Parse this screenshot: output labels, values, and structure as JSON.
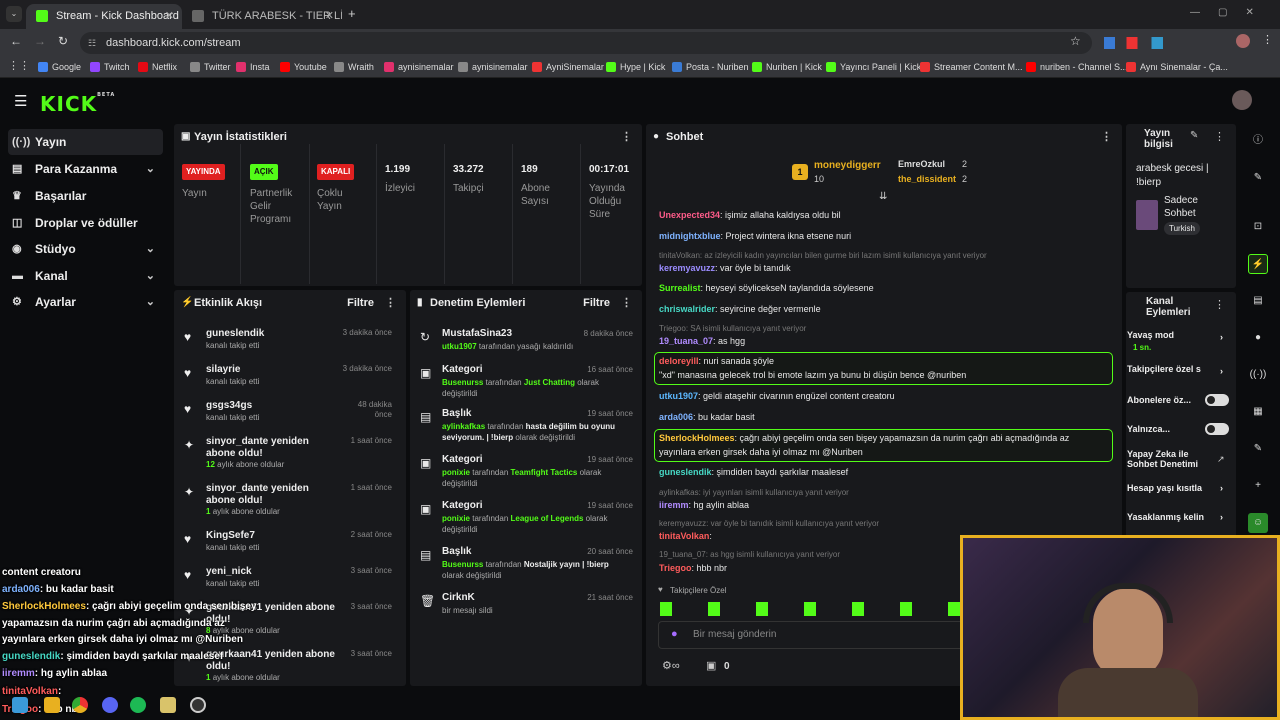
{
  "browser": {
    "tabs": [
      {
        "label": "Stream - Kick Dashboard"
      },
      {
        "label": "TÜRK ARABESK - TIER LİST - Tie"
      }
    ],
    "url": "dashboard.kick.com/stream",
    "bookmarks": [
      "Google",
      "Twitch",
      "Netflix",
      "Twitter",
      "Insta",
      "Youtube",
      "Wraith",
      "aynisinemalar",
      "aynisinemalar",
      "AyniSinemalar",
      "Hype | Kick",
      "Posta - Nuriben",
      "Nuriben | Kick",
      "Yayıncı Paneli | Kick",
      "Streamer Content M...",
      "nuriben - Channel S...",
      "Aynı Sinemalar - Ça..."
    ]
  },
  "sidebar": {
    "items": [
      "Yayın",
      "Para Kazanma",
      "Başarılar",
      "Droplar ve ödüller",
      "Stüdyo",
      "Kanal",
      "Ayarlar"
    ]
  },
  "stats": {
    "title": "Yayın İstatistikleri",
    "yayin_badge": "YAYINDA",
    "yayin_lbl": "Yayın",
    "partner_badge": "AÇIK",
    "partner_lbl": "Partnerlik Gelir Programı",
    "coklu_badge": "KAPALI",
    "coklu_lbl": "Çoklu Yayın",
    "izleyici_val": "1.199",
    "izleyici_lbl": "İzleyici",
    "takipci_val": "33.272",
    "takipci_lbl": "Takipçi",
    "abone_val": "189",
    "abone_lbl": "Abone Sayısı",
    "sure_val": "00:17:01",
    "sure_lbl": "Yayında Olduğu Süre"
  },
  "events": {
    "title": "Etkinlik Akışı",
    "filter": "Filtre",
    "items": [
      {
        "name": "guneslendik",
        "time": "3 dakika önce",
        "sub": "kanalı takip etti"
      },
      {
        "name": "silayrie",
        "time": "3 dakika önce",
        "sub": "kanalı takip etti"
      },
      {
        "name": "gsgs34gs",
        "time": "48 dakika önce",
        "sub": "kanalı takip etti"
      },
      {
        "name": "sinyor_dante yeniden abone oldu!",
        "time": "1 saat önce",
        "months": "12",
        "sub": "aylık abone oldular"
      },
      {
        "name": "sinyor_dante yeniden abone oldu!",
        "time": "1 saat önce",
        "months": "1",
        "sub": "aylık abone oldular"
      },
      {
        "name": "KingSefe7",
        "time": "2 saat önce",
        "sub": "kanalı takip etti"
      },
      {
        "name": "yeni_nick",
        "time": "3 saat önce",
        "sub": "kanalı takip etti"
      },
      {
        "name": "gourkaan41 yeniden abone oldu!",
        "time": "3 saat önce",
        "months": "8",
        "sub": "aylık abone oldular"
      },
      {
        "name": "gourkaan41 yeniden abone oldu!",
        "time": "3 saat önce",
        "months": "1",
        "sub": "aylık abone oldular"
      }
    ]
  },
  "moderation": {
    "title": "Denetim Eylemleri",
    "filter": "Filtre",
    "items": [
      {
        "name": "MustafaSina23",
        "time": "8 dakika önce",
        "user": "utku1907",
        "text": "tarafından yasağı kaldırıldı"
      },
      {
        "name": "Kategori",
        "time": "16 saat önce",
        "user": "Busenurss",
        "text": "tarafından",
        "value": "Just Chatting",
        "text2": "olarak değiştirildi"
      },
      {
        "name": "Başlık",
        "time": "19 saat önce",
        "user": "aylinkafkas",
        "text": "tarafından",
        "value": "hasta değilim bu oyunu seviyorum. | !bierp",
        "text2": "olarak değiştirildi"
      },
      {
        "name": "Kategori",
        "time": "19 saat önce",
        "user": "ponixie",
        "text": "tarafından",
        "value": "Teamfight Tactics",
        "text2": "olarak değiştirildi"
      },
      {
        "name": "Kategori",
        "time": "19 saat önce",
        "user": "ponixie",
        "text": "tarafından",
        "value": "League of Legends",
        "text2": "olarak değiştirildi"
      },
      {
        "name": "Başlık",
        "time": "20 saat önce",
        "user": "Busenurss",
        "text": "tarafından",
        "value": "Nostaljik yayın | !bierp",
        "text2": "olarak değiştirildi"
      },
      {
        "name": "CirknK",
        "time": "21 saat önce",
        "text": "bir mesajı sildi"
      }
    ]
  },
  "chat": {
    "title": "Sohbet",
    "top": [
      {
        "name": "moneydiggerr",
        "count": "10"
      },
      {
        "name": "EmreOzkul",
        "count": "2"
      },
      {
        "name": "the_dissident",
        "count": "2"
      }
    ],
    "lines": [
      {
        "user": "Unexpected34",
        "color": "#ff5c8a",
        "text": ": işimiz allaha kaldıysa oldu bil"
      },
      {
        "user": "midnightxblue",
        "color": "#7fb3ff",
        "text": ": Project wintera ikna etsene nuri"
      },
      {
        "reply": "tinitaVolkan: az izleyicili kadın yayıncıları bilen gurme biri lazım isimli kullanıcıya yanıt veriyor"
      },
      {
        "user": "keremyavuzz",
        "color": "#9b8cff",
        "text": ": var öyle bi tanıdık"
      },
      {
        "user": "Surrealist",
        "color": "#53fc18",
        "text": ": heyseyi söylicekseN taylandıda söylesene"
      },
      {
        "user": "chriswalrider",
        "color": "#47d9c6",
        "text": ": seyircine değer vermenle"
      },
      {
        "reply": "Triegoo: SA isimli kullanıcıya yanıt veriyor"
      },
      {
        "user": "19_tuana_07",
        "color": "#b18cff",
        "text": ": as hgg"
      },
      {
        "user": "deloreyill",
        "color": "#ff5c5c",
        "text": ": nuri sanada şöyle",
        "text2": "\"xd\" manasına gelecek trol bi emote lazım ya bunu bi düşün bence @nuriben"
      },
      {
        "user": "utku1907",
        "color": "#5cb8ff",
        "text": ": geldi ataşehir civarının engüzel content creatoru"
      },
      {
        "user": "arda006",
        "color": "#7fb3ff",
        "text": ": bu kadar basit"
      },
      {
        "user": "SherlockHolmees",
        "color": "#ffc93c",
        "text": ": çağrı abiyi geçelim onda sen bişey yapamazsın da nurim çağrı abi açmadığında az",
        "text2": "yayınlara erken girsek daha iyi olmaz mı @Nuriben"
      },
      {
        "user": "guneslendik",
        "color": "#47d9c6",
        "text": ": şimdiden baydı şarkılar maalesef"
      },
      {
        "reply": "aylinkafkas: iyi yayınları isimli kullanıcıya yanıt veriyor"
      },
      {
        "user": "iiremm",
        "color": "#b18cff",
        "text": ": hg aylin ablaa"
      },
      {
        "reply": "keremyavuzz: var öyle bi tanıdık isimli kullanıcıya yanıt veriyor"
      },
      {
        "user": "tinitaVolkan",
        "color": "#ff5c5c",
        "text": ":"
      },
      {
        "reply": "19_tuana_07: as hgg isimli kullanıcıya yanıt veriyor"
      },
      {
        "user": "Triegoo",
        "color": "#ff5c5c",
        "text": ": hbb nbr"
      }
    ],
    "followers_only": "Takipçilere Özel",
    "placeholder": "Bir mesaj gönderin",
    "count": "0"
  },
  "info": {
    "title": "Yayın bilgisi",
    "stream_title": "arabesk gecesi | !bierp",
    "category": "Sadece Sohbet",
    "language": "Turkish"
  },
  "channel": {
    "title": "Kanal Eylemleri",
    "items": [
      "Yavaş mod",
      "Takipçilere özel s",
      "Abonelere öz...",
      "Yalnızca...",
      "Yapay Zeka ile Sohbet Denetimi",
      "Hesap yaşı kısıtla",
      "Yasaklanmış kelin"
    ],
    "slow_value": "1 sn."
  },
  "overlay": {
    "lines": [
      {
        "user": "content creatoru",
        "text": ""
      },
      {
        "user": "arda006",
        "text": ": bu kadar basit",
        "color": "#7fb3ff"
      },
      {
        "user": "SherlockHolmees",
        "text": ": çağrı abiyi geçelim onda sen bişey",
        "color": "#ffc93c"
      },
      {
        "user": "",
        "text": "yapamazsın da nurim çağrı abi açmadığında az"
      },
      {
        "user": "",
        "text": "yayınlara erken girsek daha iyi olmaz mı @Nuriben"
      },
      {
        "user": "guneslendik",
        "text": ": şimdiden baydı şarkılar maalesef",
        "color": "#47d9c6"
      },
      {
        "user": "iiremm",
        "text": ": hg aylin ablaa",
        "color": "#b18cff"
      },
      {
        "user": "tinitaVolkan",
        "text": ":",
        "color": "#ff5c5c"
      },
      {
        "user": "Triegoo",
        "text": ": hbb nbr",
        "color": "#ff5c5c"
      }
    ]
  }
}
